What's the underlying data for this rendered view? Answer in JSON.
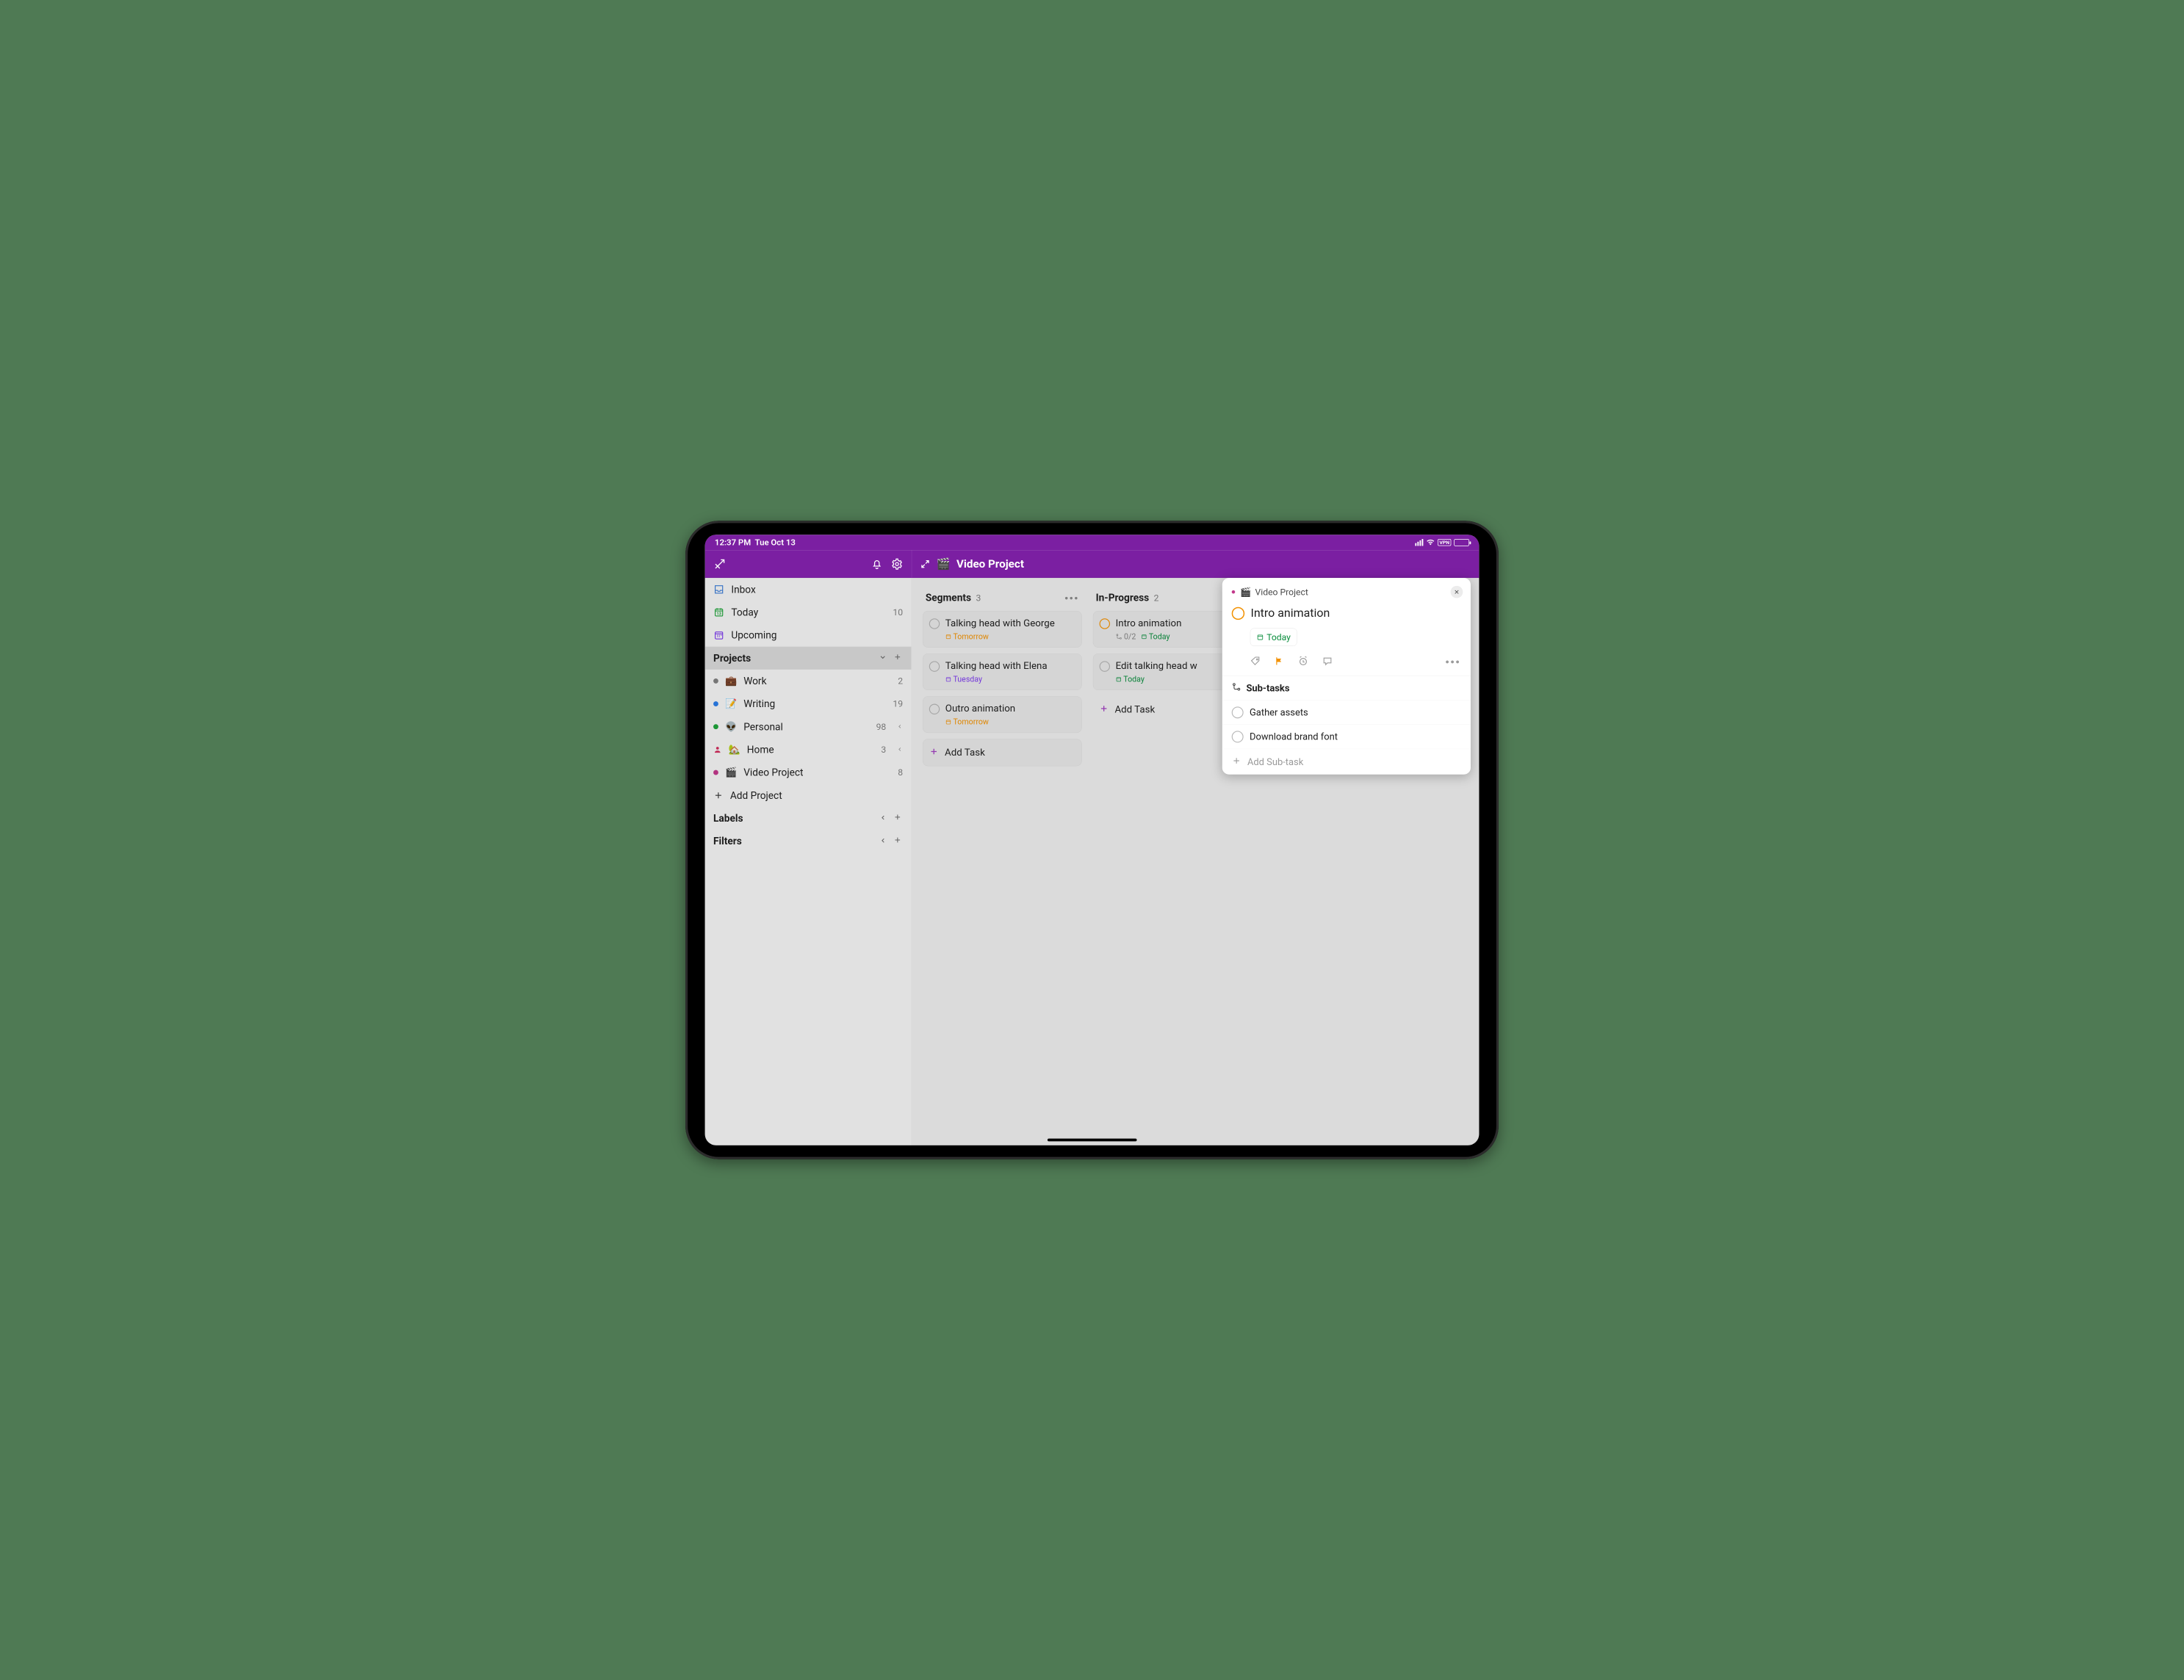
{
  "statusbar": {
    "time": "12:37 PM",
    "date": "Tue Oct 13",
    "vpn": "VPN"
  },
  "header": {
    "project_emoji": "🎬",
    "project_name": "Video Project"
  },
  "sidebar": {
    "inbox": "Inbox",
    "today": "Today",
    "today_count": "10",
    "upcoming": "Upcoming",
    "projects_label": "Projects",
    "add_project": "Add Project",
    "labels_label": "Labels",
    "filters_label": "Filters",
    "projects": [
      {
        "emoji": "💼",
        "name": "Work",
        "count": "2",
        "dot": "#808080"
      },
      {
        "emoji": "📝",
        "name": "Writing",
        "count": "19",
        "dot": "#2b7de9"
      },
      {
        "emoji": "👽",
        "name": "Personal",
        "count": "98",
        "dot": "#1fa33a",
        "chev": true
      },
      {
        "emoji": "🏡",
        "name": "Home",
        "count": "3",
        "dot": "#d12f5e",
        "chev": true,
        "person": true
      },
      {
        "emoji": "🎬",
        "name": "Video Project",
        "count": "8",
        "dot": "#c2388b"
      }
    ]
  },
  "board": {
    "columns": [
      {
        "name": "Segments",
        "count": "3",
        "cards": [
          {
            "title": "Talking head with George",
            "meta": [
              {
                "text": "Tomorrow",
                "cls": "orange",
                "icon": "cal"
              }
            ]
          },
          {
            "title": "Talking head with Elena",
            "meta": [
              {
                "text": "Tuesday",
                "cls": "purple",
                "icon": "cal"
              }
            ]
          },
          {
            "title": "Outro animation",
            "meta": [
              {
                "text": "Tomorrow",
                "cls": "orange",
                "icon": "cal"
              }
            ]
          }
        ],
        "add": "Add Task",
        "addStyle": "card"
      },
      {
        "name": "In-Progress",
        "count": "2",
        "cards": [
          {
            "title": "Intro animation",
            "circle": "orange",
            "meta": [
              {
                "text": "0/2",
                "cls": "grey",
                "icon": "sub"
              },
              {
                "text": "Today",
                "cls": "green",
                "icon": "cal"
              }
            ]
          },
          {
            "title": "Edit talking head w",
            "meta": [
              {
                "text": "Today",
                "cls": "green",
                "icon": "cal"
              }
            ]
          }
        ],
        "add": "Add Task",
        "addStyle": "naked"
      }
    ]
  },
  "panel": {
    "project_emoji": "🎬",
    "project_name": "Video Project",
    "title": "Intro animation",
    "date": "Today",
    "subtasks_label": "Sub-tasks",
    "add_subtask": "Add Sub-task",
    "subtasks": [
      {
        "title": "Gather assets"
      },
      {
        "title": "Download brand font"
      }
    ]
  }
}
